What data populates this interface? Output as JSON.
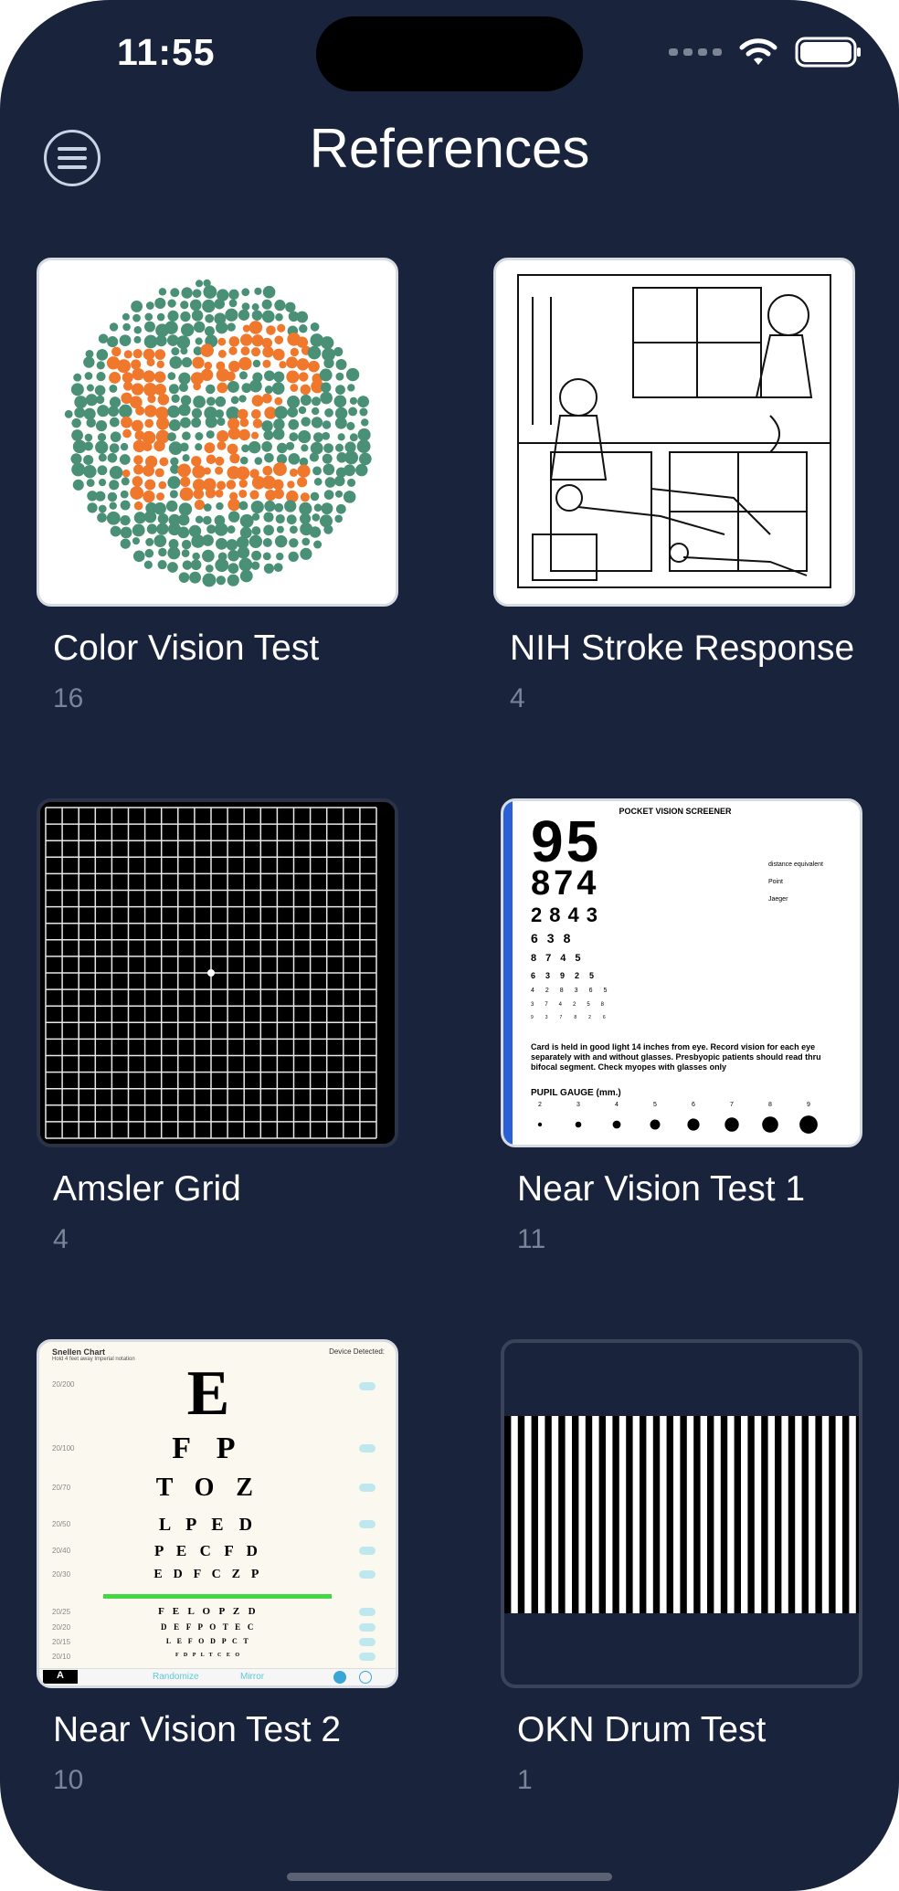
{
  "status": {
    "time": "11:55"
  },
  "header": {
    "title": "References"
  },
  "cards": [
    {
      "title": "Color Vision Test",
      "count": "16",
      "image": "ishihara-plate-12",
      "plate_number": "12"
    },
    {
      "title": "NIH Stroke Response",
      "count": "4",
      "image": "kitchen-scene-drawing"
    },
    {
      "title": "Amsler Grid",
      "count": "4",
      "image": "amsler-grid"
    },
    {
      "title": "Near Vision Test 1",
      "count": "11",
      "image": "pocket-vision-screener",
      "chart": {
        "header": "POCKET VISION SCREENER",
        "rows": [
          "95",
          "874",
          "2843",
          "638",
          "8745",
          "63925",
          "428365",
          "374258",
          "937826"
        ],
        "side_labels": [
          "distance equivalent",
          "Point",
          "Jaeger"
        ],
        "note": "Card is held in good light 14 inches from eye. Record vision for each eye separately with and without glasses. Presbyopic patients should read thru bifocal segment. Check myopes with glasses only",
        "pupil_gauge": "PUPIL GAUGE (mm.)",
        "pupil_sizes": [
          "2",
          "3",
          "4",
          "5",
          "6",
          "7",
          "8",
          "9"
        ]
      }
    },
    {
      "title": "Near Vision Test 2",
      "count": "10",
      "image": "snellen-chart",
      "chart": {
        "header": "Snellen Chart",
        "subheader": "Hold 4 feet away Imperial notation",
        "device": "Device Detected:",
        "rows": [
          {
            "ratio": "20/200",
            "letters": "E"
          },
          {
            "ratio": "20/100",
            "letters": "F P"
          },
          {
            "ratio": "20/70",
            "letters": "T O Z"
          },
          {
            "ratio": "20/50",
            "letters": "L P E D"
          },
          {
            "ratio": "20/40",
            "letters": "P E C F D"
          },
          {
            "ratio": "20/30",
            "letters": "E D F C Z P"
          },
          {
            "ratio": "20/25",
            "letters": "F E L O P Z D"
          },
          {
            "ratio": "20/20",
            "letters": "D E F P O T E C"
          },
          {
            "ratio": "20/15",
            "letters": "L E F O D P C T"
          },
          {
            "ratio": "20/10",
            "letters": "F D P L T C E O"
          }
        ],
        "footer_a": "A",
        "randomize": "Randomize",
        "mirror": "Mirror"
      }
    },
    {
      "title": "OKN Drum Test",
      "count": "1",
      "image": "okn-stripes"
    }
  ],
  "colors": {
    "background": "#19233c",
    "plate_dot": "#4a9077",
    "plate_number": "#f0782c",
    "count_text": "#7a8499"
  }
}
